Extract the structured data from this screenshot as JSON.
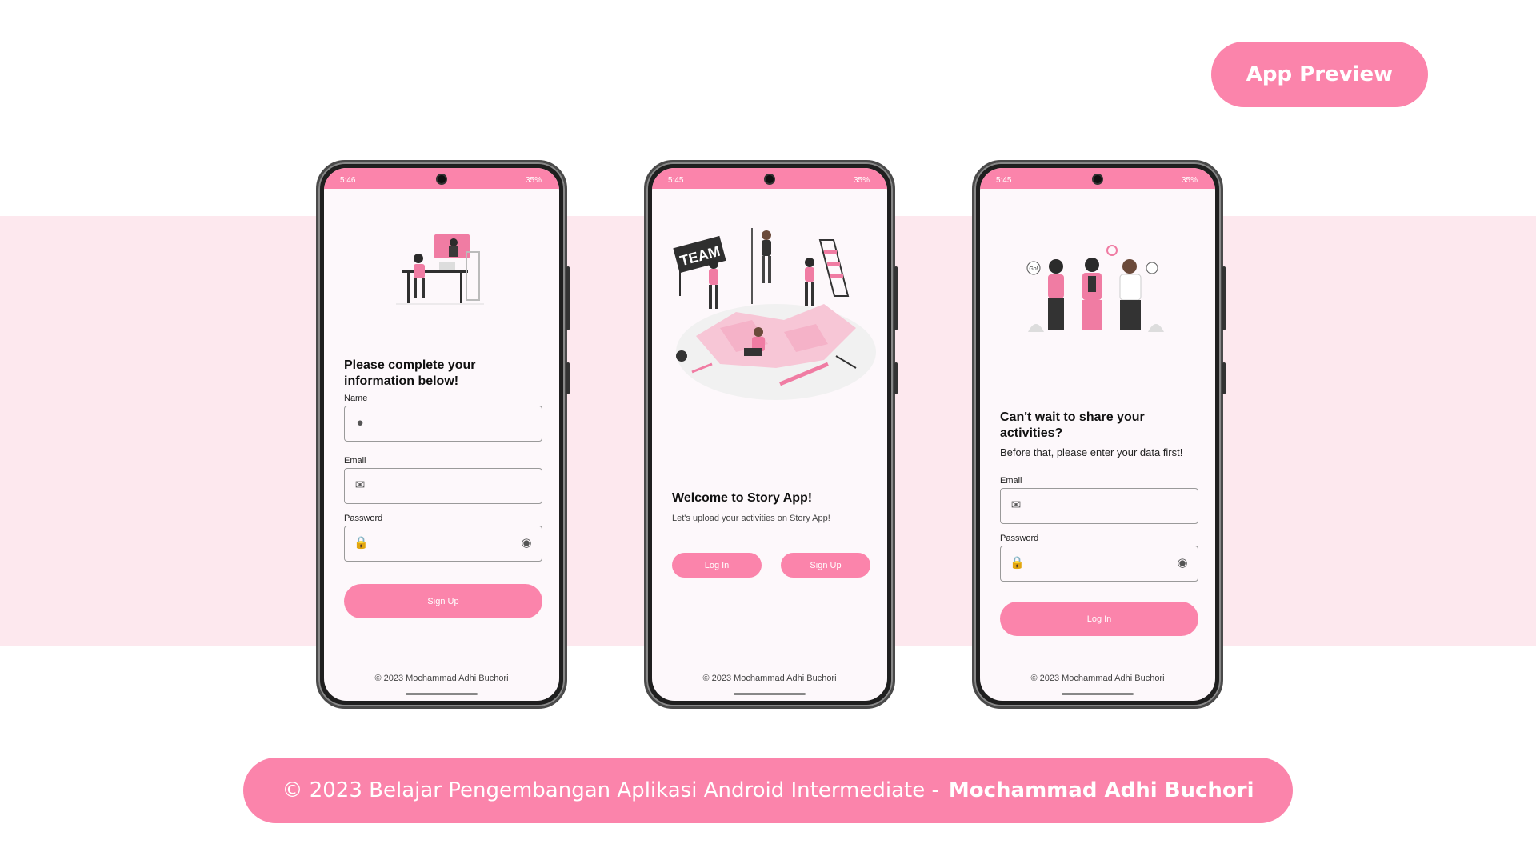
{
  "header": {
    "preview_label": "App Preview"
  },
  "footer": {
    "text": "© 2023 Belajar Pengembangan Aplikasi Android Intermediate -",
    "author": "Mochammad Adhi Buchori"
  },
  "colors": {
    "accent": "#fb84ab",
    "band": "#fde8ee",
    "screen_bg": "#fdf8fb"
  },
  "phones": [
    {
      "status": {
        "time": "5:46",
        "battery": "35%"
      },
      "title": "Please complete your information below!",
      "fields": [
        {
          "label": "Name",
          "icon": "person-icon",
          "value": ""
        },
        {
          "label": "Email",
          "icon": "mail-icon",
          "value": ""
        },
        {
          "label": "Password",
          "icon": "lock-icon",
          "value": ""
        }
      ],
      "primary_button": "Sign Up",
      "copyright": "© 2023 Mochammad Adhi Buchori"
    },
    {
      "status": {
        "time": "5:45",
        "battery": "35%"
      },
      "title": "Welcome to Story App!",
      "subtitle": "Let's upload your activities on Story App!",
      "buttons": [
        "Log In",
        "Sign Up"
      ],
      "illustration_text": "TEAM",
      "copyright": "© 2023 Mochammad Adhi Buchori"
    },
    {
      "status": {
        "time": "5:45",
        "battery": "35%"
      },
      "title": "Can't wait to share your activities?",
      "subtitle": "Before that, please enter your data first!",
      "fields": [
        {
          "label": "Email",
          "icon": "mail-icon",
          "value": ""
        },
        {
          "label": "Password",
          "icon": "lock-icon",
          "value": ""
        }
      ],
      "primary_button": "Log In",
      "illustration_text": "Go!",
      "copyright": "© 2023 Mochammad Adhi Buchori"
    }
  ]
}
